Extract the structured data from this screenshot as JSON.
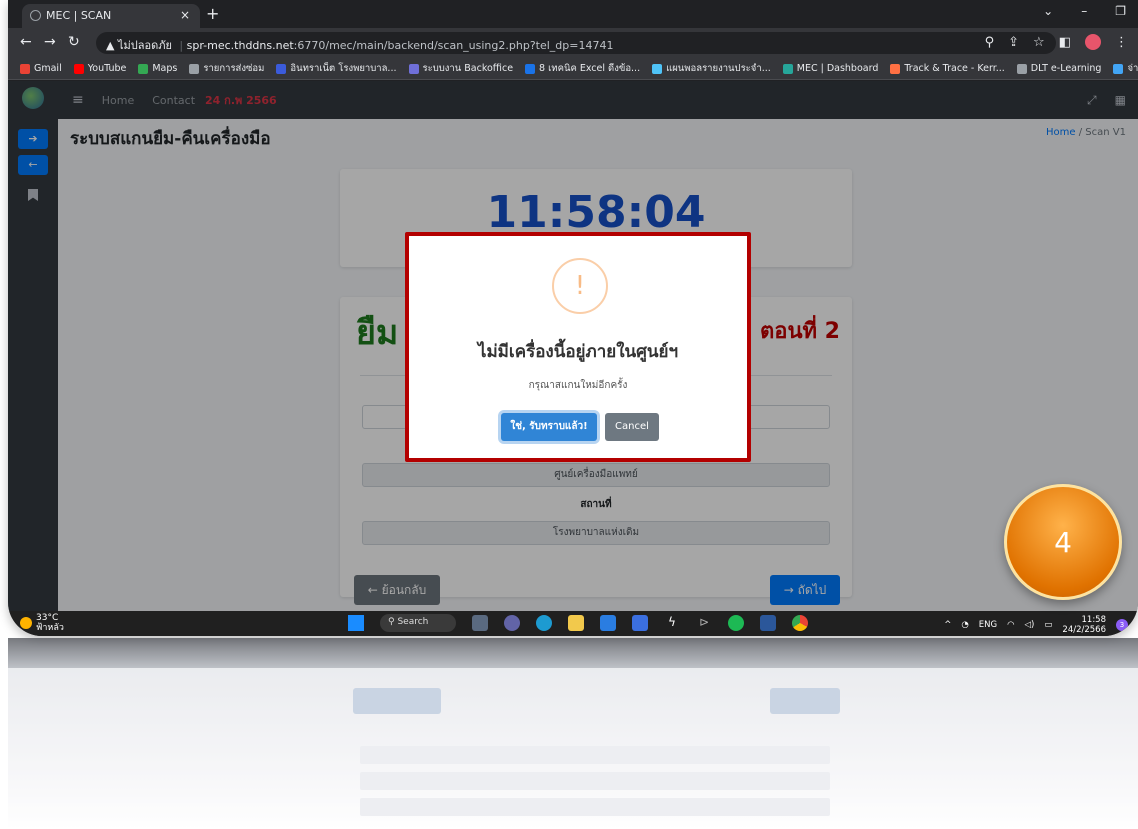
{
  "browser": {
    "tab_title": "MEC | SCAN",
    "tab_close": "×",
    "new_tab": "+",
    "url_warning": "▲ ไม่ปลอดภัย",
    "url_host": "spr-mec.thddns.net",
    "url_rest": ":6770/mec/main/backend/scan_using2.php?tel_dp=14741",
    "bookmarks": [
      {
        "label": "Gmail",
        "color": "#ea4335"
      },
      {
        "label": "YouTube",
        "color": "#ff0000"
      },
      {
        "label": "Maps",
        "color": "#34a853"
      },
      {
        "label": "รายการส่งซ่อม",
        "color": "#9aa0a6"
      },
      {
        "label": "อินทราเน็ต โรงพยาบาล...",
        "color": "#3b5bdb"
      },
      {
        "label": "ระบบงาน Backoffice",
        "color": "#6f6fd8"
      },
      {
        "label": "8 เทคนิค Excel ดีงข้อ...",
        "color": "#1a73e8"
      },
      {
        "label": "แผนพอลรายงานประจำ...",
        "color": "#4fc3f7"
      },
      {
        "label": "MEC | Dashboard",
        "color": "#26a69a"
      },
      {
        "label": "Track & Trace - Kerr...",
        "color": "#ff7043"
      },
      {
        "label": "DLT e-Learning",
        "color": "#9aa0a6"
      },
      {
        "label": "จ่ายกลาง",
        "color": "#42a5f5"
      }
    ]
  },
  "app": {
    "nav_home": "Home",
    "nav_contact": "Contact",
    "nav_date": "24 ก.พ 2566",
    "page_title": "ระบบสแกนยืม-คืนเครื่องมือ",
    "breadcrumb_home": "Home",
    "breadcrumb_sep": "/",
    "breadcrumb_current": "Scan V1",
    "clock": "11:58:04",
    "heading_left": "ยืม",
    "heading_right": "ตอนที่ 2",
    "field_department": "ศูนย์เครื่องมือแพทย์",
    "label_location": "สถานที่",
    "field_location": "โรงพยาบาลแห่งเดิม",
    "back_button": "← ย้อนกลับ",
    "next_button": "→ ถัดไป"
  },
  "modal": {
    "icon": "!",
    "title": "ไม่มีเครื่องนี้อยู่ภายในศูนย์ฯ",
    "text": "กรุณาสแกนใหม่อีกครั้ง",
    "confirm": "ใช่, รับทราบแล้ว!",
    "cancel": "Cancel"
  },
  "taskbar": {
    "temp": "33°C",
    "weather": "ฟ้าหลัว",
    "search": "Search",
    "lang": "ENG",
    "time": "11:58",
    "date": "24/2/2566",
    "notifications": "3"
  },
  "badge": "4"
}
